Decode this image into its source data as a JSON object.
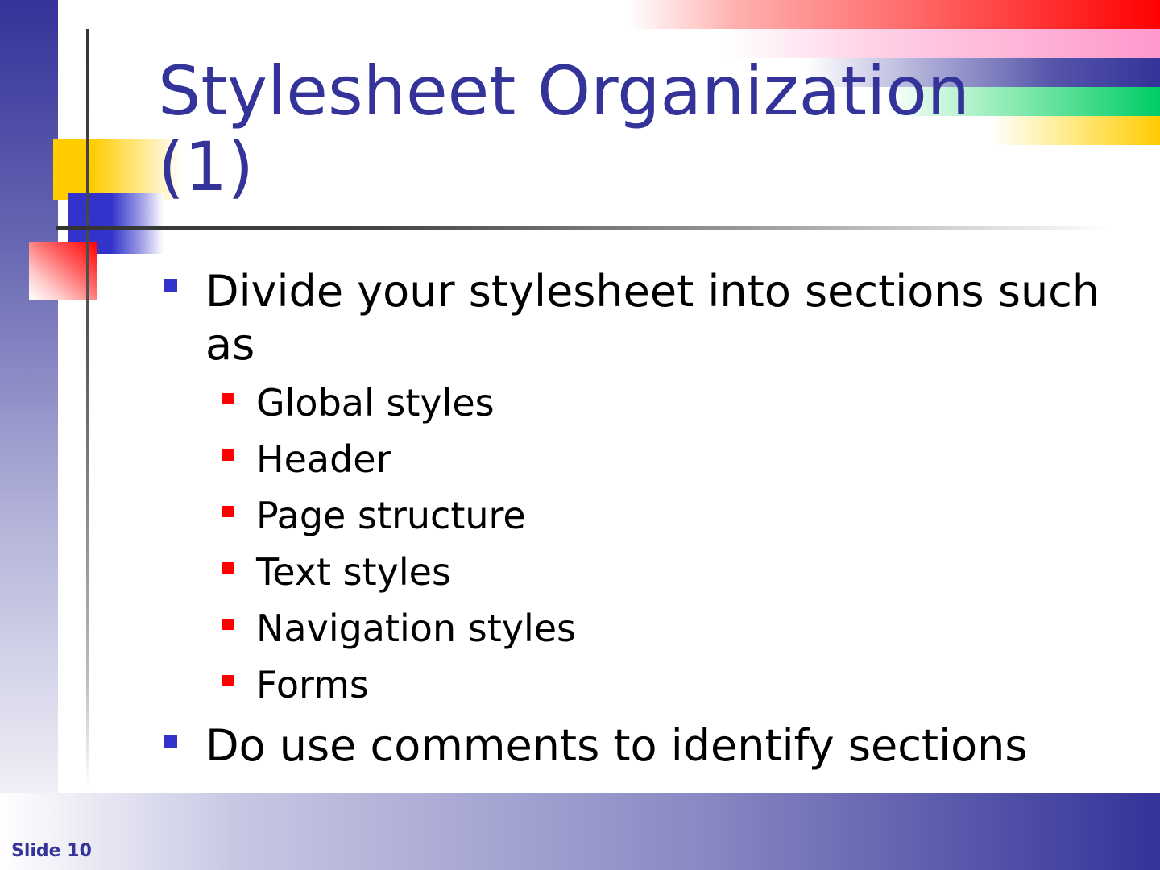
{
  "slide": {
    "title": "Stylesheet Organization (1)",
    "bullets": [
      "Divide your stylesheet into sections such as",
      "Do use comments to identify sections"
    ],
    "sub_bullets": [
      "Global styles",
      "Header",
      "Page structure",
      "Text styles",
      "Navigation styles",
      "Forms"
    ],
    "slide_number_label": "Slide 10"
  },
  "colors": {
    "title": "#333399",
    "level1_bullet": "#3333cc",
    "level2_bullet": "#ff0000",
    "text": "#000000"
  }
}
